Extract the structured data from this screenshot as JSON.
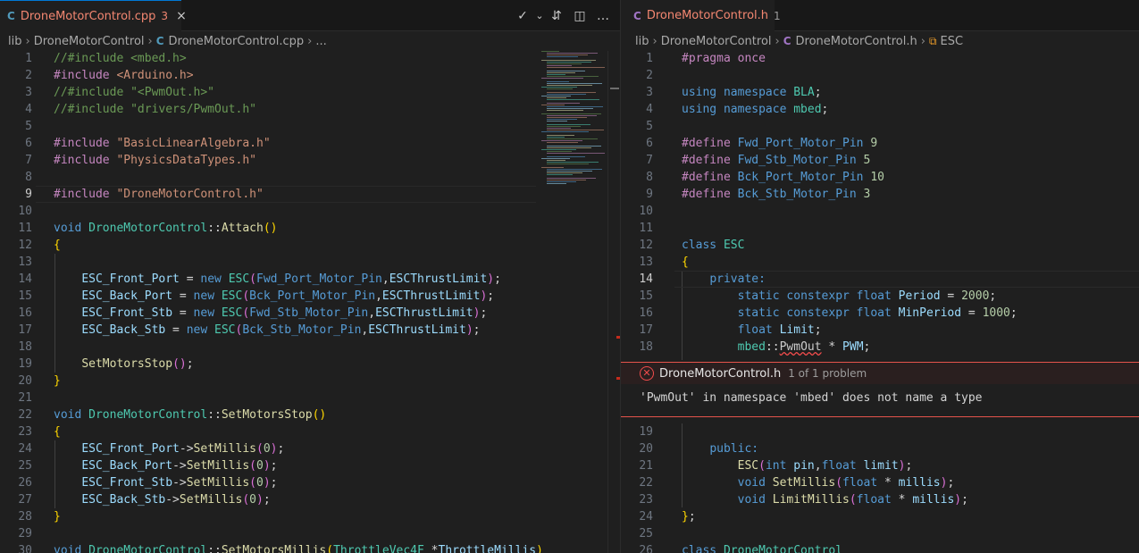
{
  "left": {
    "tab": {
      "icon": "C-icon",
      "icon_text": "C",
      "name": "DroneMotorControl.cpp",
      "problems": "3",
      "close": "×"
    },
    "actions": [
      "✓",
      "⌄",
      "⇵",
      "◫",
      "…"
    ],
    "breadcrumb": [
      "lib",
      "DroneMotorControl",
      "DroneMotorControl.cpp",
      "..."
    ],
    "lines": [
      {
        "n": "1",
        "t": [
          [
            "cm",
            "//#include <mbed.h>"
          ]
        ]
      },
      {
        "n": "2",
        "t": [
          [
            "pp",
            "#include "
          ],
          [
            "st",
            "<Arduino.h>"
          ]
        ]
      },
      {
        "n": "3",
        "t": [
          [
            "cm",
            "//#include \"<PwmOut.h>\""
          ]
        ]
      },
      {
        "n": "4",
        "t": [
          [
            "cm",
            "//#include \"drivers/PwmOut.h\""
          ]
        ]
      },
      {
        "n": "5",
        "t": []
      },
      {
        "n": "6",
        "t": [
          [
            "pp",
            "#include "
          ],
          [
            "st",
            "\"BasicLinearAlgebra.h\""
          ]
        ]
      },
      {
        "n": "7",
        "t": [
          [
            "pp",
            "#include "
          ],
          [
            "st",
            "\"PhysicsDataTypes.h\""
          ]
        ]
      },
      {
        "n": "8",
        "t": []
      },
      {
        "n": "9",
        "t": [
          [
            "pp",
            "#include "
          ],
          [
            "st",
            "\"DroneMotorControl.h\""
          ]
        ]
      },
      {
        "n": "10",
        "t": []
      },
      {
        "n": "11",
        "t": [
          [
            "kw",
            "void "
          ],
          [
            "ty",
            "DroneMotorControl"
          ],
          [
            "op",
            "::"
          ],
          [
            "fn",
            "Attach"
          ],
          [
            "br1",
            "()"
          ]
        ]
      },
      {
        "n": "12",
        "t": [
          [
            "br1",
            "{"
          ]
        ]
      },
      {
        "n": "13",
        "t": []
      },
      {
        "n": "14",
        "t": [
          [
            "op",
            "    "
          ],
          [
            "va",
            "ESC_Front_Port"
          ],
          [
            "op",
            " = "
          ],
          [
            "kw",
            "new "
          ],
          [
            "ty",
            "ESC"
          ],
          [
            "br2",
            "("
          ],
          [
            "mc",
            "Fwd_Port_Motor_Pin"
          ],
          [
            "op",
            ","
          ],
          [
            "va",
            "ESCThrustLimit"
          ],
          [
            "br2",
            ")"
          ],
          [
            "op",
            ";"
          ]
        ]
      },
      {
        "n": "15",
        "t": [
          [
            "op",
            "    "
          ],
          [
            "va",
            "ESC_Back_Port"
          ],
          [
            "op",
            " = "
          ],
          [
            "kw",
            "new "
          ],
          [
            "ty",
            "ESC"
          ],
          [
            "br2",
            "("
          ],
          [
            "mc",
            "Bck_Port_Motor_Pin"
          ],
          [
            "op",
            ","
          ],
          [
            "va",
            "ESCThrustLimit"
          ],
          [
            "br2",
            ")"
          ],
          [
            "op",
            ";"
          ]
        ]
      },
      {
        "n": "16",
        "t": [
          [
            "op",
            "    "
          ],
          [
            "va",
            "ESC_Front_Stb"
          ],
          [
            "op",
            " = "
          ],
          [
            "kw",
            "new "
          ],
          [
            "ty",
            "ESC"
          ],
          [
            "br2",
            "("
          ],
          [
            "mc",
            "Fwd_Stb_Motor_Pin"
          ],
          [
            "op",
            ","
          ],
          [
            "va",
            "ESCThrustLimit"
          ],
          [
            "br2",
            ")"
          ],
          [
            "op",
            ";"
          ]
        ]
      },
      {
        "n": "17",
        "t": [
          [
            "op",
            "    "
          ],
          [
            "va",
            "ESC_Back_Stb"
          ],
          [
            "op",
            " = "
          ],
          [
            "kw",
            "new "
          ],
          [
            "ty",
            "ESC"
          ],
          [
            "br2",
            "("
          ],
          [
            "mc",
            "Bck_Stb_Motor_Pin"
          ],
          [
            "op",
            ","
          ],
          [
            "va",
            "ESCThrustLimit"
          ],
          [
            "br2",
            ")"
          ],
          [
            "op",
            ";"
          ]
        ]
      },
      {
        "n": "18",
        "t": []
      },
      {
        "n": "19",
        "t": [
          [
            "op",
            "    "
          ],
          [
            "fn",
            "SetMotorsStop"
          ],
          [
            "br2",
            "()"
          ],
          [
            "op",
            ";"
          ]
        ]
      },
      {
        "n": "20",
        "t": [
          [
            "br1",
            "}"
          ]
        ]
      },
      {
        "n": "21",
        "t": []
      },
      {
        "n": "22",
        "t": [
          [
            "kw",
            "void "
          ],
          [
            "ty",
            "DroneMotorControl"
          ],
          [
            "op",
            "::"
          ],
          [
            "fn",
            "SetMotorsStop"
          ],
          [
            "br1",
            "()"
          ]
        ]
      },
      {
        "n": "23",
        "t": [
          [
            "br1",
            "{"
          ]
        ]
      },
      {
        "n": "24",
        "t": [
          [
            "op",
            "    "
          ],
          [
            "va",
            "ESC_Front_Port"
          ],
          [
            "op",
            "->"
          ],
          [
            "fn",
            "SetMillis"
          ],
          [
            "br2",
            "("
          ],
          [
            "nu",
            "0"
          ],
          [
            "br2",
            ")"
          ],
          [
            "op",
            ";"
          ]
        ]
      },
      {
        "n": "25",
        "t": [
          [
            "op",
            "    "
          ],
          [
            "va",
            "ESC_Back_Port"
          ],
          [
            "op",
            "->"
          ],
          [
            "fn",
            "SetMillis"
          ],
          [
            "br2",
            "("
          ],
          [
            "nu",
            "0"
          ],
          [
            "br2",
            ")"
          ],
          [
            "op",
            ";"
          ]
        ]
      },
      {
        "n": "26",
        "t": [
          [
            "op",
            "    "
          ],
          [
            "va",
            "ESC_Front_Stb"
          ],
          [
            "op",
            "->"
          ],
          [
            "fn",
            "SetMillis"
          ],
          [
            "br2",
            "("
          ],
          [
            "nu",
            "0"
          ],
          [
            "br2",
            ")"
          ],
          [
            "op",
            ";"
          ]
        ]
      },
      {
        "n": "27",
        "t": [
          [
            "op",
            "    "
          ],
          [
            "va",
            "ESC_Back_Stb"
          ],
          [
            "op",
            "->"
          ],
          [
            "fn",
            "SetMillis"
          ],
          [
            "br2",
            "("
          ],
          [
            "nu",
            "0"
          ],
          [
            "br2",
            ")"
          ],
          [
            "op",
            ";"
          ]
        ]
      },
      {
        "n": "28",
        "t": [
          [
            "br1",
            "}"
          ]
        ]
      },
      {
        "n": "29",
        "t": []
      },
      {
        "n": "30",
        "t": [
          [
            "kw",
            "void "
          ],
          [
            "ty",
            "DroneMotorControl"
          ],
          [
            "op",
            "::"
          ],
          [
            "fn",
            "SetMotorsMillis"
          ],
          [
            "br1",
            "("
          ],
          [
            "ty",
            "ThrottleVec4F "
          ],
          [
            "op",
            "*"
          ],
          [
            "va",
            "ThrottleMillis"
          ],
          [
            "br1",
            ")"
          ]
        ]
      }
    ]
  },
  "right": {
    "tab": {
      "icon": "C-icon",
      "icon_text": "C",
      "name": "DroneMotorControl.h",
      "problems": "1",
      "close": "×"
    },
    "breadcrumb": [
      "lib",
      "DroneMotorControl",
      "DroneMotorControl.h",
      "ESC"
    ],
    "lines_top": [
      {
        "n": "1",
        "t": [
          [
            "pp",
            "#pragma "
          ],
          [
            "pp",
            "once"
          ]
        ]
      },
      {
        "n": "2",
        "t": []
      },
      {
        "n": "3",
        "t": [
          [
            "kw",
            "using namespace "
          ],
          [
            "ty",
            "BLA"
          ],
          [
            "op",
            ";"
          ]
        ]
      },
      {
        "n": "4",
        "t": [
          [
            "kw",
            "using namespace "
          ],
          [
            "ty",
            "mbed"
          ],
          [
            "op",
            ";"
          ]
        ]
      },
      {
        "n": "5",
        "t": []
      },
      {
        "n": "6",
        "t": [
          [
            "pp",
            "#define "
          ],
          [
            "mc",
            "Fwd_Port_Motor_Pin "
          ],
          [
            "nu",
            "9"
          ]
        ]
      },
      {
        "n": "7",
        "t": [
          [
            "pp",
            "#define "
          ],
          [
            "mc",
            "Fwd_Stb_Motor_Pin "
          ],
          [
            "nu",
            "5"
          ]
        ]
      },
      {
        "n": "8",
        "t": [
          [
            "pp",
            "#define "
          ],
          [
            "mc",
            "Bck_Port_Motor_Pin "
          ],
          [
            "nu",
            "10"
          ]
        ]
      },
      {
        "n": "9",
        "t": [
          [
            "pp",
            "#define "
          ],
          [
            "mc",
            "Bck_Stb_Motor_Pin "
          ],
          [
            "nu",
            "3"
          ]
        ]
      },
      {
        "n": "10",
        "t": []
      },
      {
        "n": "11",
        "t": []
      },
      {
        "n": "12",
        "t": [
          [
            "kw",
            "class "
          ],
          [
            "ty",
            "ESC"
          ]
        ]
      },
      {
        "n": "13",
        "t": [
          [
            "br1",
            "{"
          ]
        ]
      },
      {
        "n": "14",
        "t": [
          [
            "op",
            "    "
          ],
          [
            "kw",
            "private:"
          ]
        ]
      },
      {
        "n": "15",
        "t": [
          [
            "op",
            "        "
          ],
          [
            "kw",
            "static constexpr float "
          ],
          [
            "va",
            "Period"
          ],
          [
            "op",
            " = "
          ],
          [
            "nu",
            "2000"
          ],
          [
            "op",
            ";"
          ]
        ]
      },
      {
        "n": "16",
        "t": [
          [
            "op",
            "        "
          ],
          [
            "kw",
            "static constexpr float "
          ],
          [
            "va",
            "MinPeriod"
          ],
          [
            "op",
            " = "
          ],
          [
            "nu",
            "1000"
          ],
          [
            "op",
            ";"
          ]
        ]
      },
      {
        "n": "17",
        "t": [
          [
            "op",
            "        "
          ],
          [
            "kw",
            "float "
          ],
          [
            "va",
            "Limit"
          ],
          [
            "op",
            ";"
          ]
        ]
      },
      {
        "n": "18",
        "t": [
          [
            "op",
            "        "
          ],
          [
            "ty",
            "mbed"
          ],
          [
            "op",
            "::"
          ],
          [
            "err",
            "PwmOut"
          ],
          [
            "op",
            " * "
          ],
          [
            "va",
            "PWM"
          ],
          [
            "op",
            ";"
          ]
        ]
      }
    ],
    "peek": {
      "file": "DroneMotorControl.h",
      "count": "1 of 1 problem",
      "message": "'PwmOut' in namespace 'mbed' does not name a type"
    },
    "lines_bottom": [
      {
        "n": "19",
        "t": []
      },
      {
        "n": "20",
        "t": [
          [
            "op",
            "    "
          ],
          [
            "kw",
            "public:"
          ]
        ]
      },
      {
        "n": "21",
        "t": [
          [
            "op",
            "        "
          ],
          [
            "fn",
            "ESC"
          ],
          [
            "br2",
            "("
          ],
          [
            "kw",
            "int "
          ],
          [
            "va",
            "pin"
          ],
          [
            "op",
            ","
          ],
          [
            "kw",
            "float "
          ],
          [
            "va",
            "limit"
          ],
          [
            "br2",
            ")"
          ],
          [
            "op",
            ";"
          ]
        ]
      },
      {
        "n": "22",
        "t": [
          [
            "op",
            "        "
          ],
          [
            "kw",
            "void "
          ],
          [
            "fn",
            "SetMillis"
          ],
          [
            "br2",
            "("
          ],
          [
            "kw",
            "float "
          ],
          [
            "op",
            "* "
          ],
          [
            "va",
            "millis"
          ],
          [
            "br2",
            ")"
          ],
          [
            "op",
            ";"
          ]
        ]
      },
      {
        "n": "23",
        "t": [
          [
            "op",
            "        "
          ],
          [
            "kw",
            "void "
          ],
          [
            "fn",
            "LimitMillis"
          ],
          [
            "br2",
            "("
          ],
          [
            "kw",
            "float "
          ],
          [
            "op",
            "* "
          ],
          [
            "va",
            "millis"
          ],
          [
            "br2",
            ")"
          ],
          [
            "op",
            ";"
          ]
        ]
      },
      {
        "n": "24",
        "t": [
          [
            "br1",
            "}"
          ],
          [
            "op",
            ";"
          ]
        ]
      },
      {
        "n": "25",
        "t": []
      },
      {
        "n": "26",
        "t": [
          [
            "kw",
            "class "
          ],
          [
            "ty",
            "DroneMotorControl"
          ]
        ]
      }
    ]
  },
  "colors": {
    "error": "#f14c4c",
    "tab_error_text": "#f48771",
    "background": "#1f1f1f"
  }
}
